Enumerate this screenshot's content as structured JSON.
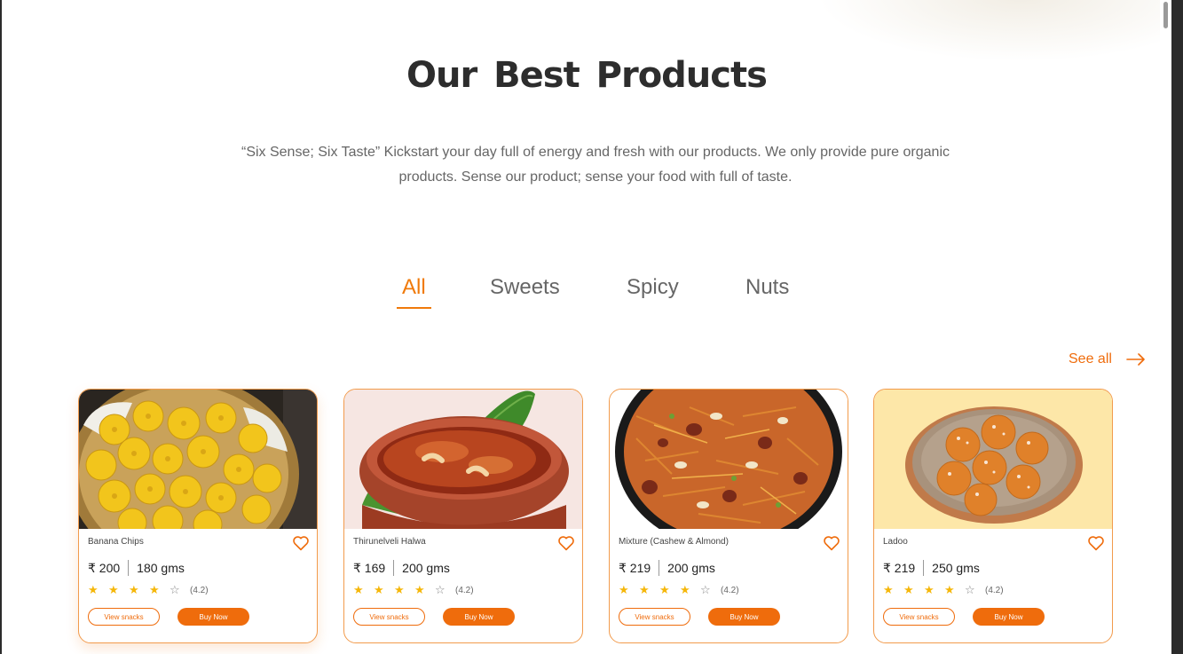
{
  "header": {
    "title": "Our Best Products",
    "subtitle": "“Six Sense; Six Taste” Kickstart your day full of energy and fresh with our products. We only provide pure organic products. Sense our product; sense your food with full of taste."
  },
  "tabs": [
    {
      "label": "All",
      "active": true
    },
    {
      "label": "Sweets",
      "active": false
    },
    {
      "label": "Spicy",
      "active": false
    },
    {
      "label": "Nuts",
      "active": false
    }
  ],
  "see_all_label": "See all",
  "products": [
    {
      "name": "Banana Chips",
      "price": "₹ 200",
      "weight": "180 gms",
      "rating": "(4.2)",
      "stars": 4,
      "view_label": "View snacks",
      "buy_label": "Buy Now",
      "image": "banana-chips-image"
    },
    {
      "name": "Thirunelveli Halwa",
      "price": "₹ 169",
      "weight": "200 gms",
      "rating": "(4.2)",
      "stars": 4,
      "view_label": "View snacks",
      "buy_label": "Buy Now",
      "image": "halwa-image"
    },
    {
      "name": "Mixture (Cashew & Almond)",
      "price": "₹ 219",
      "weight": "200 gms",
      "rating": "(4.2)",
      "stars": 4,
      "view_label": "View snacks",
      "buy_label": "Buy Now",
      "image": "mixture-image"
    },
    {
      "name": "Ladoo",
      "price": "₹ 219",
      "weight": "250 gms",
      "rating": "(4.2)",
      "stars": 4,
      "view_label": "View snacks",
      "buy_label": "Buy Now",
      "image": "ladoo-image"
    }
  ],
  "colors": {
    "accent": "#ef6c0c",
    "star": "#f5b70a",
    "title": "#2d2d2d",
    "text": "#666666"
  },
  "icons": {
    "favorite": "heart-outline-icon",
    "see_all": "arrow-right-icon",
    "rating_full": "star-filled-icon",
    "rating_empty": "star-outline-icon"
  }
}
